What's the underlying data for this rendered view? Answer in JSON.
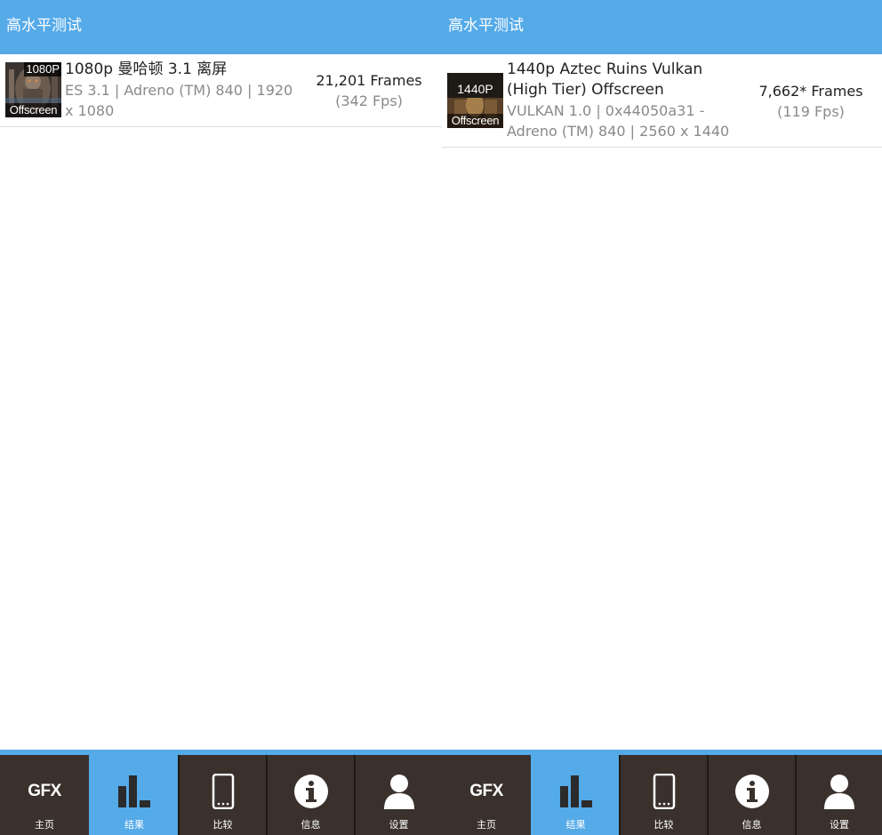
{
  "panes": [
    {
      "appbar_title": "高水平测试",
      "result": {
        "thumb_top": "1080P",
        "thumb_bottom": "Offscreen",
        "name": "1080p 曼哈顿 3.1 离屏",
        "subtitle": "ES 3.1 | Adreno (TM) 840 | 1920 x 1080",
        "frames": "21,201 Frames",
        "fps": "(342 Fps)"
      },
      "nav": [
        "主页",
        "结果",
        "比较",
        "信息",
        "设置"
      ],
      "nav_logo": "GFX",
      "active_tab": "结果"
    },
    {
      "appbar_title": "高水平测试",
      "result": {
        "thumb_top": "1440P",
        "thumb_bottom": "Offscreen",
        "name": "1440p Aztec Ruins Vulkan (High Tier) Offscreen",
        "subtitle": "VULKAN 1.0 | 0x44050a31 - Adreno (TM) 840 | 2560 x 1440",
        "frames": "7,662* Frames",
        "fps": "(119 Fps)"
      },
      "nav": [
        "主页",
        "结果",
        "比较",
        "信息",
        "设置"
      ],
      "nav_logo": "GFX",
      "active_tab": "结果"
    }
  ],
  "icons": [
    "gfx-logo-icon",
    "bar-chart-icon",
    "phone-icon",
    "info-icon",
    "user-icon"
  ],
  "colors": {
    "accent": "#55aae8",
    "nav_background": "#3a312c",
    "text": "#222222",
    "muted": "#8a8a8a"
  }
}
